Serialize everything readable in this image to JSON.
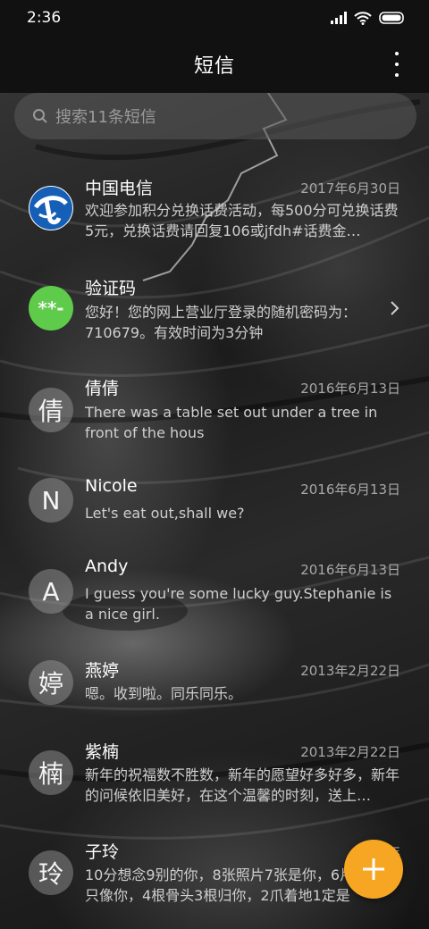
{
  "status_bar": {
    "time": "2:36"
  },
  "header": {
    "title": "短信"
  },
  "search": {
    "placeholder": "搜索11条短信"
  },
  "conversations": [
    {
      "name": "中国电信",
      "date": "2017年6月30日",
      "snippet": "欢迎参加积分兑换话费活动，每500分可兑换话费5元，兑换话费请回复106或jfdh#话费金…",
      "avatar": "china-telecom-logo-icon"
    },
    {
      "name": "验证码",
      "date": "",
      "snippet": "您好！您的网上营业厅登录的随机密码为：710679。有效时间为3分钟",
      "avatar_text": "**-",
      "avatar_color": "#5ecb4a"
    },
    {
      "name": "倩倩",
      "date": "2016年6月13日",
      "snippet": "There was a table set out under a tree in front of the hous",
      "avatar_text": "倩"
    },
    {
      "name": "Nicole",
      "date": "2016年6月13日",
      "snippet": "Let's eat out,shall we?",
      "avatar_text": "N"
    },
    {
      "name": "Andy",
      "date": "2016年6月13日",
      "snippet": "I guess you're some lucky guy.Stephanie is a nice girl.",
      "avatar_text": "A"
    },
    {
      "name": "燕婷",
      "date": "2013年2月22日",
      "snippet": "嗯。收到啦。同乐同乐。",
      "avatar_text": "婷"
    },
    {
      "name": "紫楠",
      "date": "2013年2月22日",
      "snippet": "新年的祝福数不胜数，新年的愿望好多好多，新年的问候依旧美好，在这个温馨的时刻，送上…",
      "avatar_text": "楠"
    },
    {
      "name": "子玲",
      "date": "2013年",
      "snippet": "10分想念9别的你，8张照片7张是你，6片… 只像你，4根骨头3根归你，2爪着地1定是你，…",
      "avatar_text": "玲"
    }
  ],
  "colors": {
    "accent_fab": "#f6a623",
    "verification_avatar": "#5ecb4a",
    "telecom_blue": "#1560b6"
  }
}
